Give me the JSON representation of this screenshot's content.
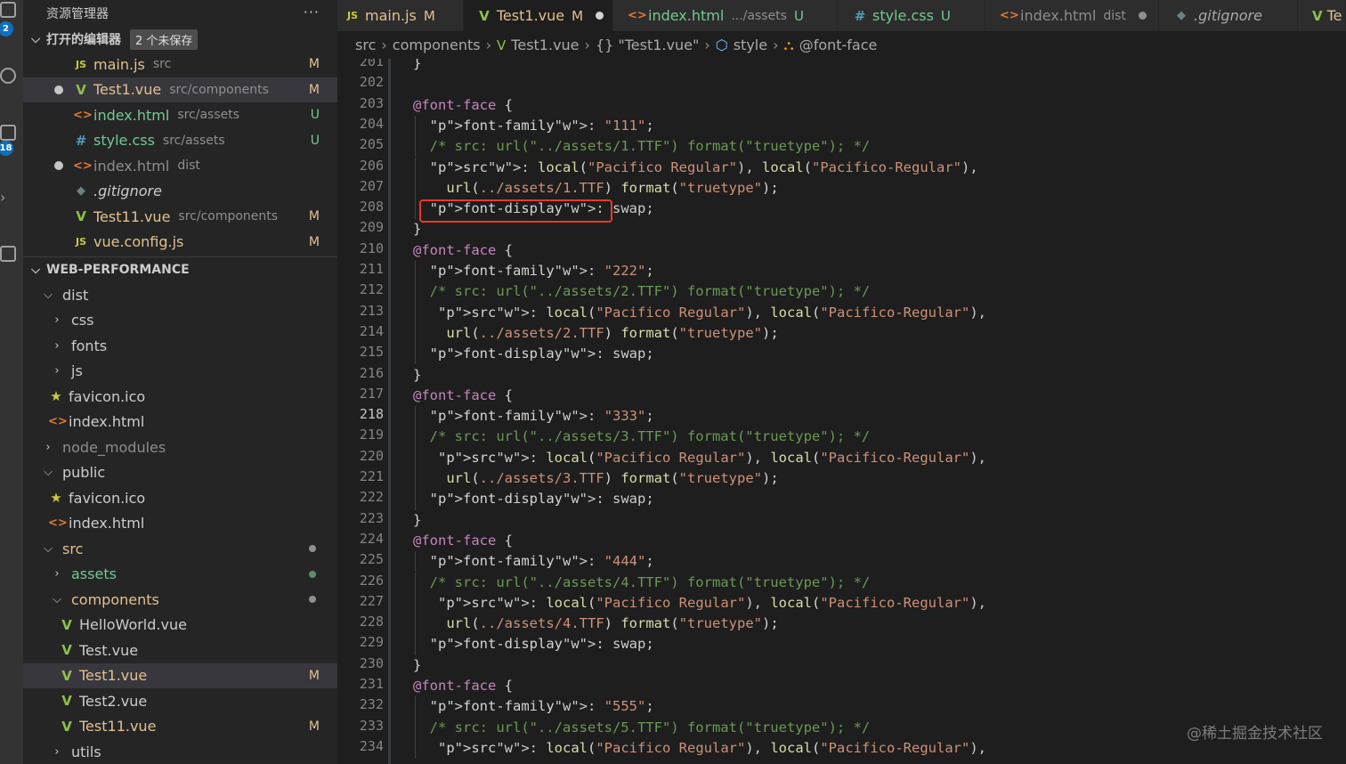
{
  "activity_bar": {
    "badge1": "2",
    "badge2": "18"
  },
  "sidebar": {
    "title": "资源管理器",
    "more": "···",
    "open_editors": {
      "label": "打开的编辑器",
      "unsaved_badge": "2 个未保存",
      "items": [
        {
          "icon": "JS",
          "name": "main.js",
          "desc": "src",
          "status": "M"
        },
        {
          "icon": "V",
          "name": "Test1.vue",
          "desc": "src/components",
          "status": "M"
        },
        {
          "icon": "<>",
          "name": "index.html",
          "desc": "src/assets",
          "status": "U"
        },
        {
          "icon": "#",
          "name": "style.css",
          "desc": "src/assets",
          "status": "U"
        },
        {
          "icon": "<>",
          "name": "index.html",
          "desc": "dist",
          "status": ""
        },
        {
          "icon": "◆",
          "name": ".gitignore",
          "desc": "",
          "status": ""
        },
        {
          "icon": "V",
          "name": "Test11.vue",
          "desc": "src/components",
          "status": "M"
        },
        {
          "icon": "JS",
          "name": "vue.config.js",
          "desc": "",
          "status": "M"
        }
      ]
    },
    "project": {
      "label": "WEB-PERFORMANCE",
      "items": [
        {
          "name": "dist",
          "status": ""
        },
        {
          "name": "css",
          "status": ""
        },
        {
          "name": "fonts",
          "status": ""
        },
        {
          "name": "js",
          "status": ""
        },
        {
          "name": "favicon.ico",
          "status": ""
        },
        {
          "name": "index.html",
          "status": ""
        },
        {
          "name": "node_modules",
          "status": ""
        },
        {
          "name": "public",
          "status": ""
        },
        {
          "name": "favicon.ico",
          "status": ""
        },
        {
          "name": "index.html",
          "status": ""
        },
        {
          "name": "src",
          "status": ""
        },
        {
          "name": "assets",
          "status": ""
        },
        {
          "name": "components",
          "status": ""
        },
        {
          "name": "HelloWorld.vue",
          "status": ""
        },
        {
          "name": "Test.vue",
          "status": ""
        },
        {
          "name": "Test1.vue",
          "status": "M"
        },
        {
          "name": "Test2.vue",
          "status": ""
        },
        {
          "name": "Test11.vue",
          "status": "M"
        },
        {
          "name": "utils",
          "status": ""
        }
      ]
    }
  },
  "tabs": [
    {
      "icon": "JS",
      "name": "main.js",
      "desc": "",
      "status": "M"
    },
    {
      "icon": "V",
      "name": "Test1.vue",
      "desc": "",
      "status": "M"
    },
    {
      "icon": "<>",
      "name": "index.html",
      "desc": ".../assets",
      "status": "U"
    },
    {
      "icon": "#",
      "name": "style.css",
      "desc": "",
      "status": "U"
    },
    {
      "icon": "<>",
      "name": "index.html",
      "desc": "dist",
      "status": ""
    },
    {
      "icon": "◆",
      "name": ".gitignore",
      "desc": "",
      "status": ""
    },
    {
      "icon": "V",
      "name": "Te",
      "desc": "",
      "status": ""
    }
  ],
  "breadcrumb": [
    "src",
    "components",
    "Test1.vue",
    "{} \"Test1.vue\"",
    "style",
    "@font-face"
  ],
  "editor": {
    "current_line": "218",
    "line_numbers": [
      "201",
      "202",
      "203",
      "204",
      "205",
      "206",
      "207",
      "208",
      "209",
      "210",
      "211",
      "212",
      "213",
      "214",
      "215",
      "216",
      "217",
      "218",
      "219",
      "220",
      "221",
      "222",
      "223",
      "224",
      "225",
      "226",
      "227",
      "228",
      "229",
      "230",
      "231",
      "232",
      "233",
      "234"
    ],
    "lines": [
      "}",
      "",
      "@font-face {",
      "  font-family: \"111\";",
      "  /* src: url(\"../assets/1.TTF\") format(\"truetype\"); */",
      "  src: local(\"Pacifico Regular\"), local(\"Pacifico-Regular\"),",
      "    url(../assets/1.TTF) format(\"truetype\");",
      "  font-display: swap;",
      "}",
      "@font-face {",
      "  font-family: \"222\";",
      "  /* src: url(\"../assets/2.TTF\") format(\"truetype\"); */",
      "   src: local(\"Pacifico Regular\"), local(\"Pacifico-Regular\"),",
      "    url(../assets/2.TTF) format(\"truetype\");",
      "  font-display: swap;",
      "}",
      "@font-face {",
      "  font-family: \"333\";",
      "  /* src: url(\"../assets/3.TTF\") format(\"truetype\"); */",
      "   src: local(\"Pacifico Regular\"), local(\"Pacifico-Regular\"),",
      "    url(../assets/3.TTF) format(\"truetype\");",
      "  font-display: swap;",
      "}",
      "@font-face {",
      "  font-family: \"444\";",
      "  /* src: url(\"../assets/4.TTF\") format(\"truetype\"); */",
      "   src: local(\"Pacifico Regular\"), local(\"Pacifico-Regular\"),",
      "    url(../assets/4.TTF) format(\"truetype\");",
      "  font-display: swap;",
      "}",
      "@font-face {",
      "  font-family: \"555\";",
      "  /* src: url(\"../assets/5.TTF\") format(\"truetype\"); */",
      "   src: local(\"Pacifico Regular\"), local(\"Pacifico-Regular\"),"
    ]
  },
  "watermark": "@稀土掘金技术社区",
  "colors": {
    "modified": "#e2c08d",
    "untracked": "#73c991",
    "highlight_box": "#e8392c",
    "vue": "#8dc149"
  }
}
